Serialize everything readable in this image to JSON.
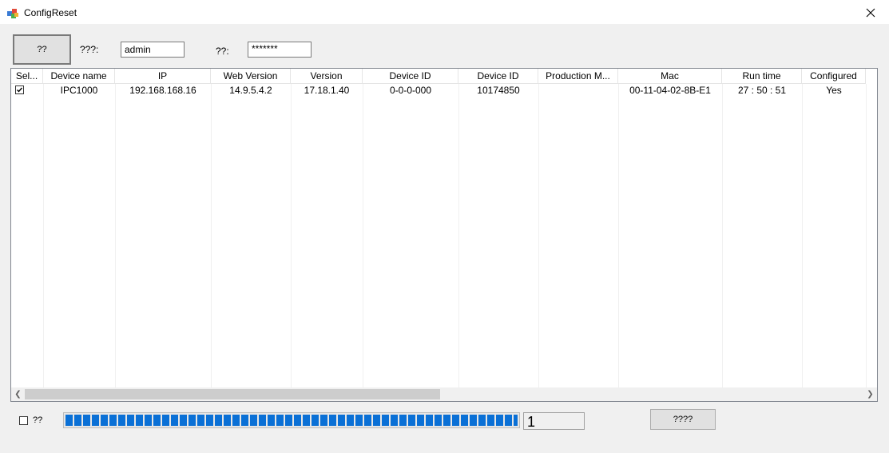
{
  "window": {
    "title": "ConfigReset",
    "close_icon": "close-icon",
    "app_icon": "app-icon"
  },
  "toolbar": {
    "action_button_label": "??",
    "username_label": "???:",
    "username_value": "admin",
    "password_label": "??:",
    "password_value": "*******"
  },
  "table": {
    "columns": [
      "Sel...",
      "Device name",
      "IP",
      "Web Version",
      "Version",
      "Device ID",
      "Device ID",
      "Production M...",
      "Mac",
      "Run time",
      "Configured"
    ],
    "rows": [
      {
        "selected": true,
        "cells": [
          "",
          "IPC1000",
          "192.168.168.16",
          "14.9.5.4.2",
          "17.18.1.40",
          "0-0-0-000",
          "10174850",
          "",
          "00-11-04-02-8B-E1",
          "27 : 50 : 51",
          "Yes"
        ]
      }
    ],
    "scroll_left_icon": "chevron-left-icon",
    "scroll_right_icon": "chevron-right-icon"
  },
  "footer": {
    "checkbox_label": "??",
    "checkbox_checked": false,
    "progress_percent": 100,
    "count_value": "1",
    "action_button_label": "????"
  },
  "colors": {
    "progress": "#0a70d6",
    "background": "#f0f0f0"
  }
}
